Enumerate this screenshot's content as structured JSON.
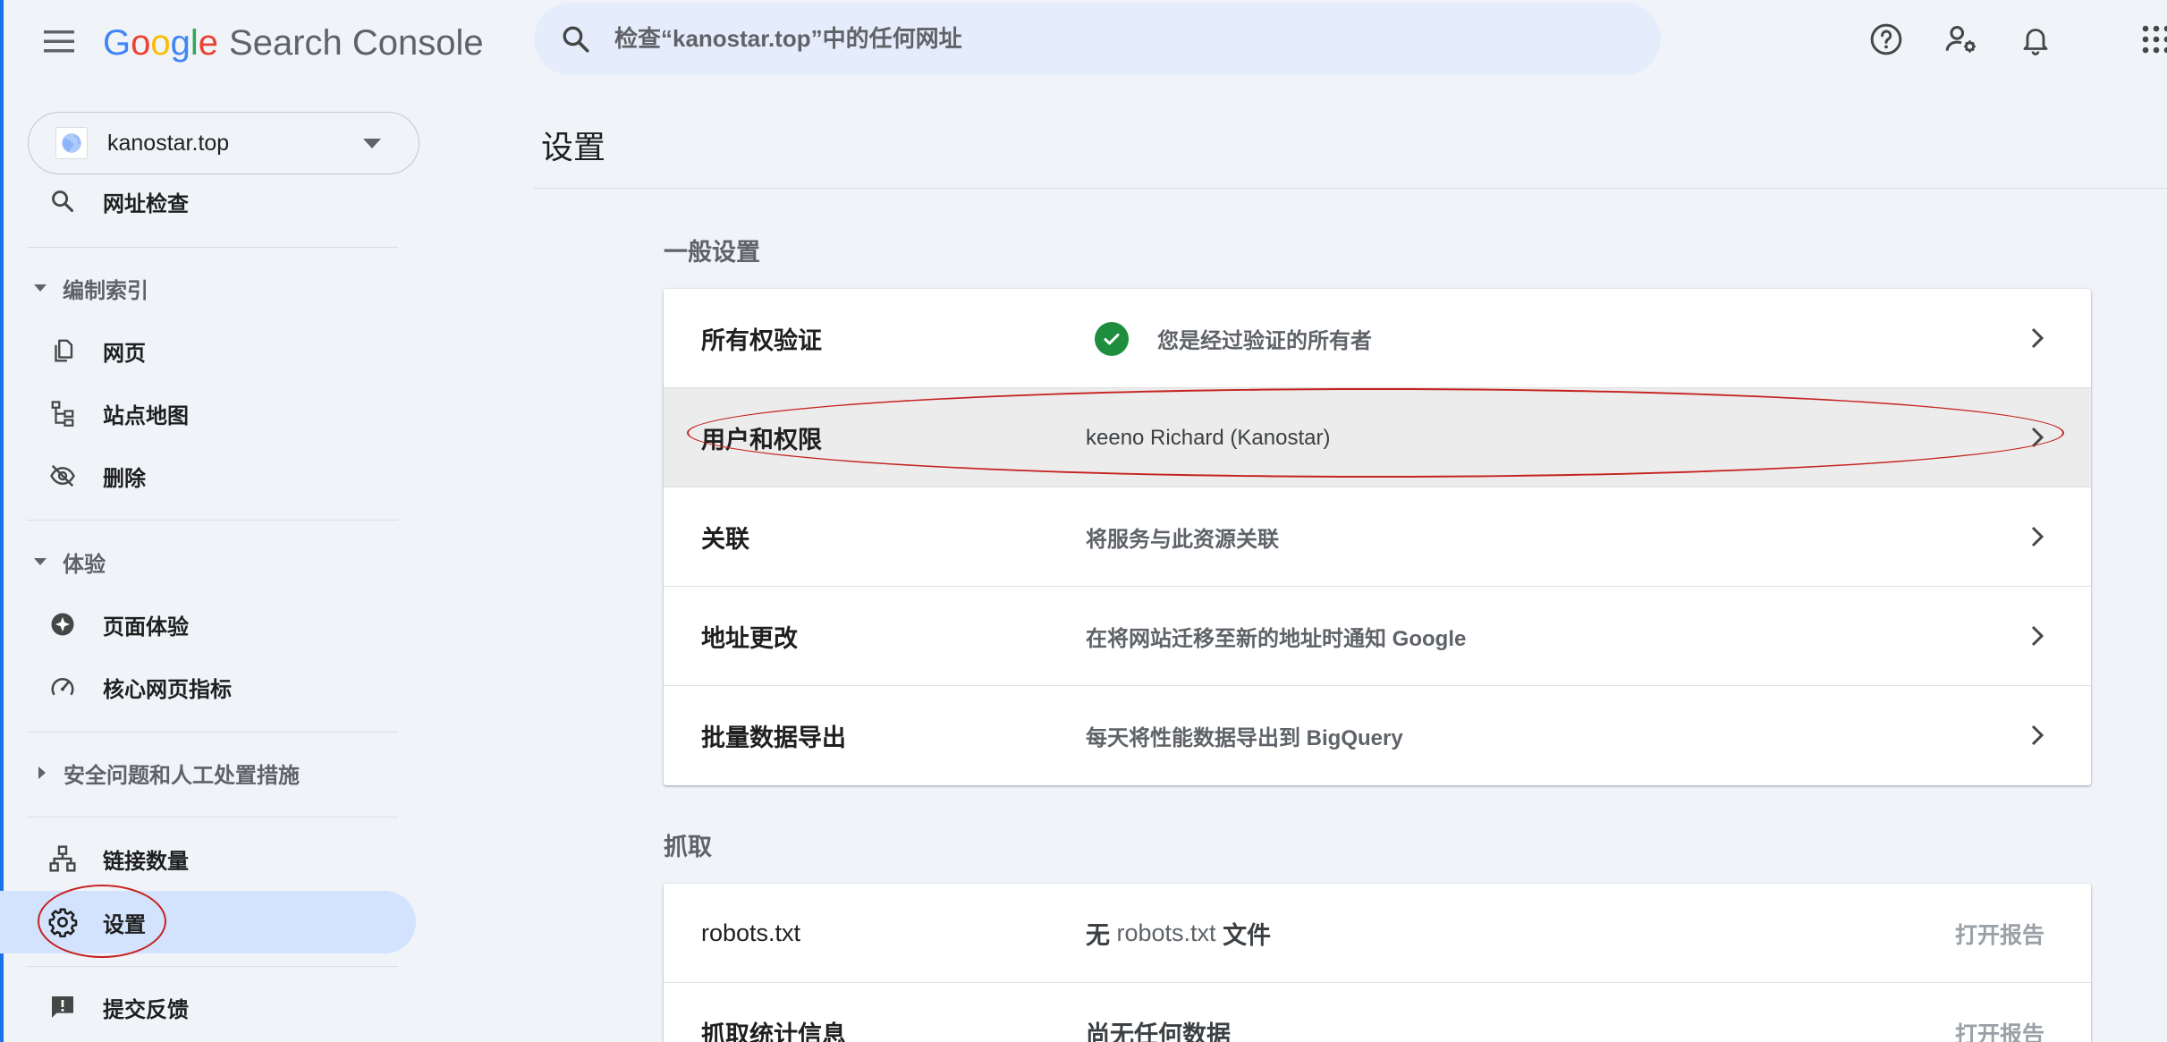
{
  "header": {
    "logo_letters": [
      "G",
      "o",
      "o",
      "g",
      "l",
      "e"
    ],
    "product_name": "Search Console",
    "search_placeholder": "检查“kanostar.top”中的任何网址"
  },
  "property": {
    "name": "kanostar.top"
  },
  "sidebar": {
    "url_inspection": "网址检查",
    "indexing": {
      "label": "编制索引",
      "items": [
        "网页",
        "站点地图",
        "删除"
      ]
    },
    "experience": {
      "label": "体验",
      "items": [
        "页面体验",
        "核心网页指标"
      ]
    },
    "security": {
      "label": "安全问题和人工处置措施"
    },
    "links": "链接数量",
    "settings": "设置",
    "feedback": "提交反馈"
  },
  "main": {
    "title": "设置",
    "general": {
      "label": "一般设置",
      "rows": [
        {
          "title": "所有权验证",
          "desc": "您是经过验证的所有者"
        },
        {
          "title": "用户和权限",
          "desc": "keeno Richard (Kanostar)"
        },
        {
          "title": "关联",
          "desc": "将服务与此资源关联"
        },
        {
          "title": "地址更改",
          "desc": "在将网站迁移至新的地址时通知 Google"
        },
        {
          "title": "批量数据导出",
          "desc": "每天将性能数据导出到 BigQuery"
        }
      ]
    },
    "crawl": {
      "label": "抓取",
      "rows": [
        {
          "title": "robots.txt",
          "desc_prefix": "无",
          "desc_mid": " robots.txt ",
          "desc_suffix": "文件",
          "link": "打开报告"
        },
        {
          "title": "抓取统计信息",
          "desc": "尚无任何数据",
          "link": "打开报告"
        }
      ]
    }
  },
  "colors": {
    "accent": "#1a73e8",
    "active_nav": "#d3e3fd",
    "verified": "#1e8e3e",
    "annotation": "#c5221f"
  }
}
